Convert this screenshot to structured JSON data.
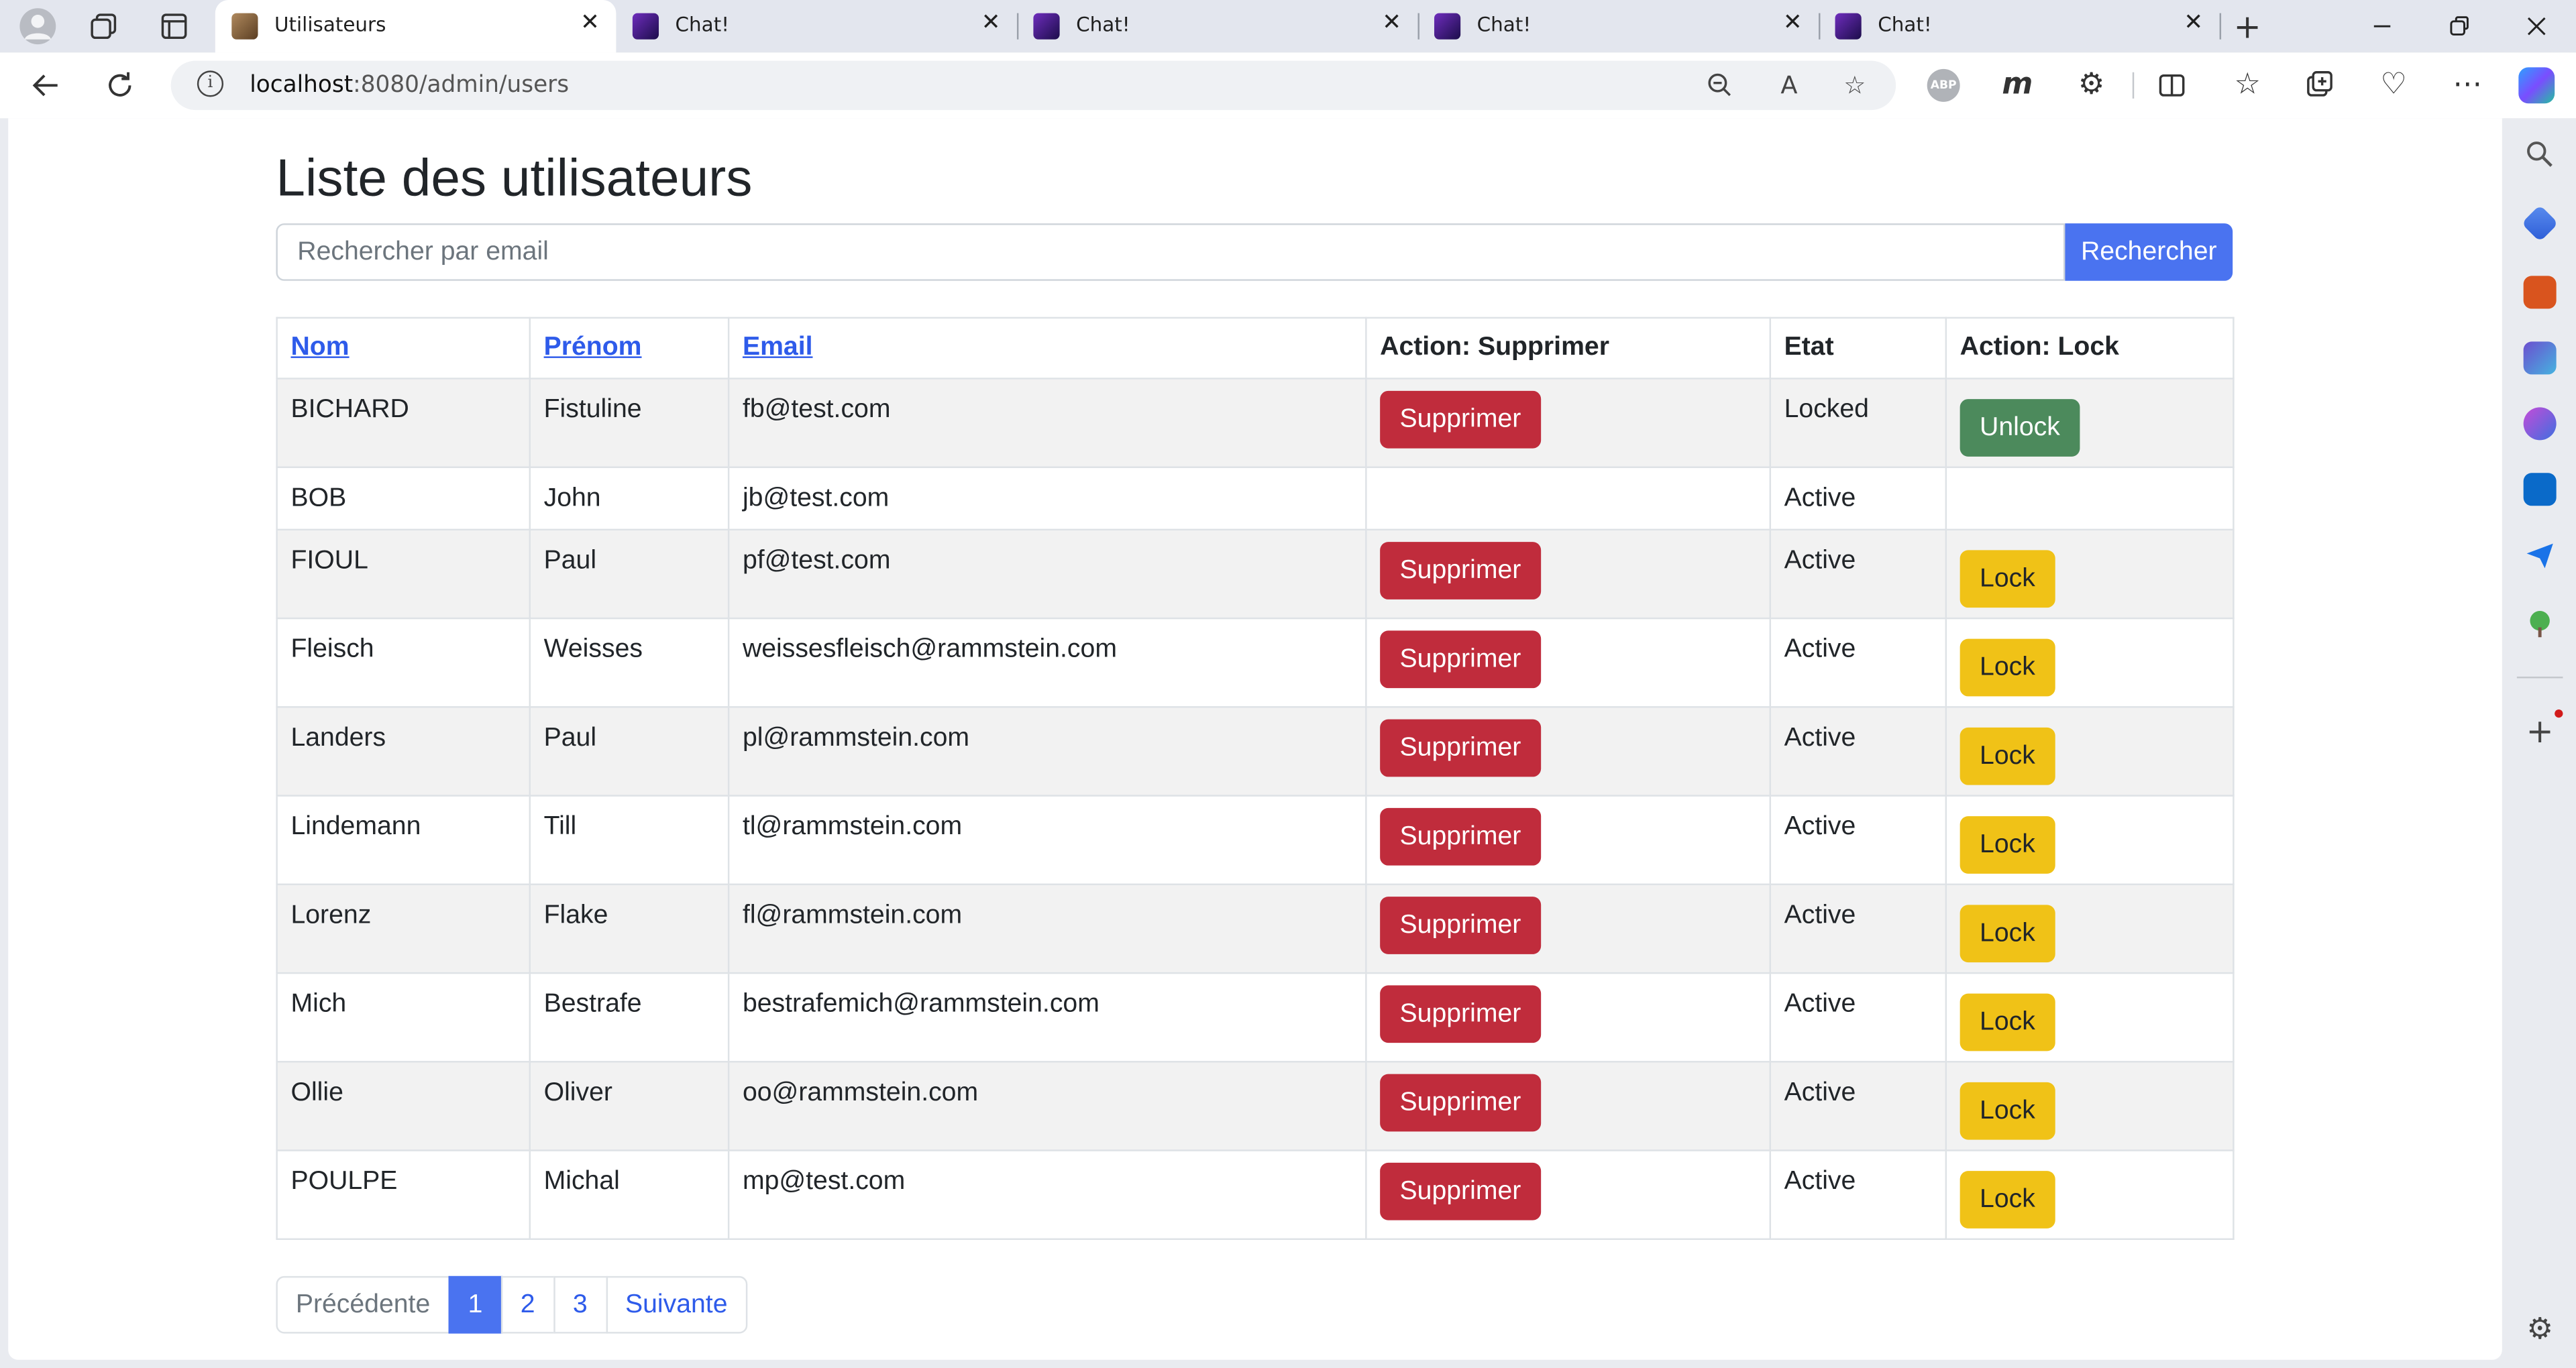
{
  "browser": {
    "tabs": [
      {
        "title": "Utilisateurs",
        "favicon": "user-photo-favicon",
        "active": true
      },
      {
        "title": "Chat!",
        "favicon": "chat-app-favicon",
        "active": false
      },
      {
        "title": "Chat!",
        "favicon": "chat-app-favicon",
        "active": false
      },
      {
        "title": "Chat!",
        "favicon": "chat-app-favicon",
        "active": false
      },
      {
        "title": "Chat!",
        "favicon": "chat-app-favicon",
        "active": false
      }
    ],
    "url_host": "localhost",
    "url_rest": ":8080/admin/users",
    "readaloud_label": "A",
    "abp_label": "ABP",
    "m_label": "m"
  },
  "page": {
    "title": "Liste des utilisateurs",
    "search": {
      "placeholder": "Rechercher par email",
      "value": "",
      "button_label": "Rechercher"
    },
    "table": {
      "headers": {
        "nom": "Nom",
        "prenom": "Prénom",
        "email": "Email",
        "action_delete": "Action: Supprimer",
        "etat": "Etat",
        "action_lock": "Action: Lock"
      },
      "rows": [
        {
          "nom": "BICHARD",
          "prenom": "Fistuline",
          "email": "fb@test.com",
          "delete": "Supprimer",
          "etat": "Locked",
          "lock_action": "Unlock"
        },
        {
          "nom": "BOB",
          "prenom": "John",
          "email": "jb@test.com",
          "delete": "",
          "etat": "Active",
          "lock_action": ""
        },
        {
          "nom": "FIOUL",
          "prenom": "Paul",
          "email": "pf@test.com",
          "delete": "Supprimer",
          "etat": "Active",
          "lock_action": "Lock"
        },
        {
          "nom": "Fleisch",
          "prenom": "Weisses",
          "email": "weissesfleisch@rammstein.com",
          "delete": "Supprimer",
          "etat": "Active",
          "lock_action": "Lock"
        },
        {
          "nom": "Landers",
          "prenom": "Paul",
          "email": "pl@rammstein.com",
          "delete": "Supprimer",
          "etat": "Active",
          "lock_action": "Lock"
        },
        {
          "nom": "Lindemann",
          "prenom": "Till",
          "email": "tl@rammstein.com",
          "delete": "Supprimer",
          "etat": "Active",
          "lock_action": "Lock"
        },
        {
          "nom": "Lorenz",
          "prenom": "Flake",
          "email": "fl@rammstein.com",
          "delete": "Supprimer",
          "etat": "Active",
          "lock_action": "Lock"
        },
        {
          "nom": "Mich",
          "prenom": "Bestrafe",
          "email": "bestrafemich@rammstein.com",
          "delete": "Supprimer",
          "etat": "Active",
          "lock_action": "Lock"
        },
        {
          "nom": "Ollie",
          "prenom": "Oliver",
          "email": "oo@rammstein.com",
          "delete": "Supprimer",
          "etat": "Active",
          "lock_action": "Lock"
        },
        {
          "nom": "POULPE",
          "prenom": "Michal",
          "email": "mp@test.com",
          "delete": "Supprimer",
          "etat": "Active",
          "lock_action": "Lock"
        }
      ]
    },
    "pagination": {
      "previous": "Précédente",
      "pages": [
        "1",
        "2",
        "3"
      ],
      "current": "1",
      "next": "Suivante"
    }
  },
  "colors": {
    "primary": "#4a73f0",
    "danger": "#c02c3c",
    "success": "#4c8a5c",
    "warning": "#f0c217",
    "link": "#2e5bea"
  }
}
